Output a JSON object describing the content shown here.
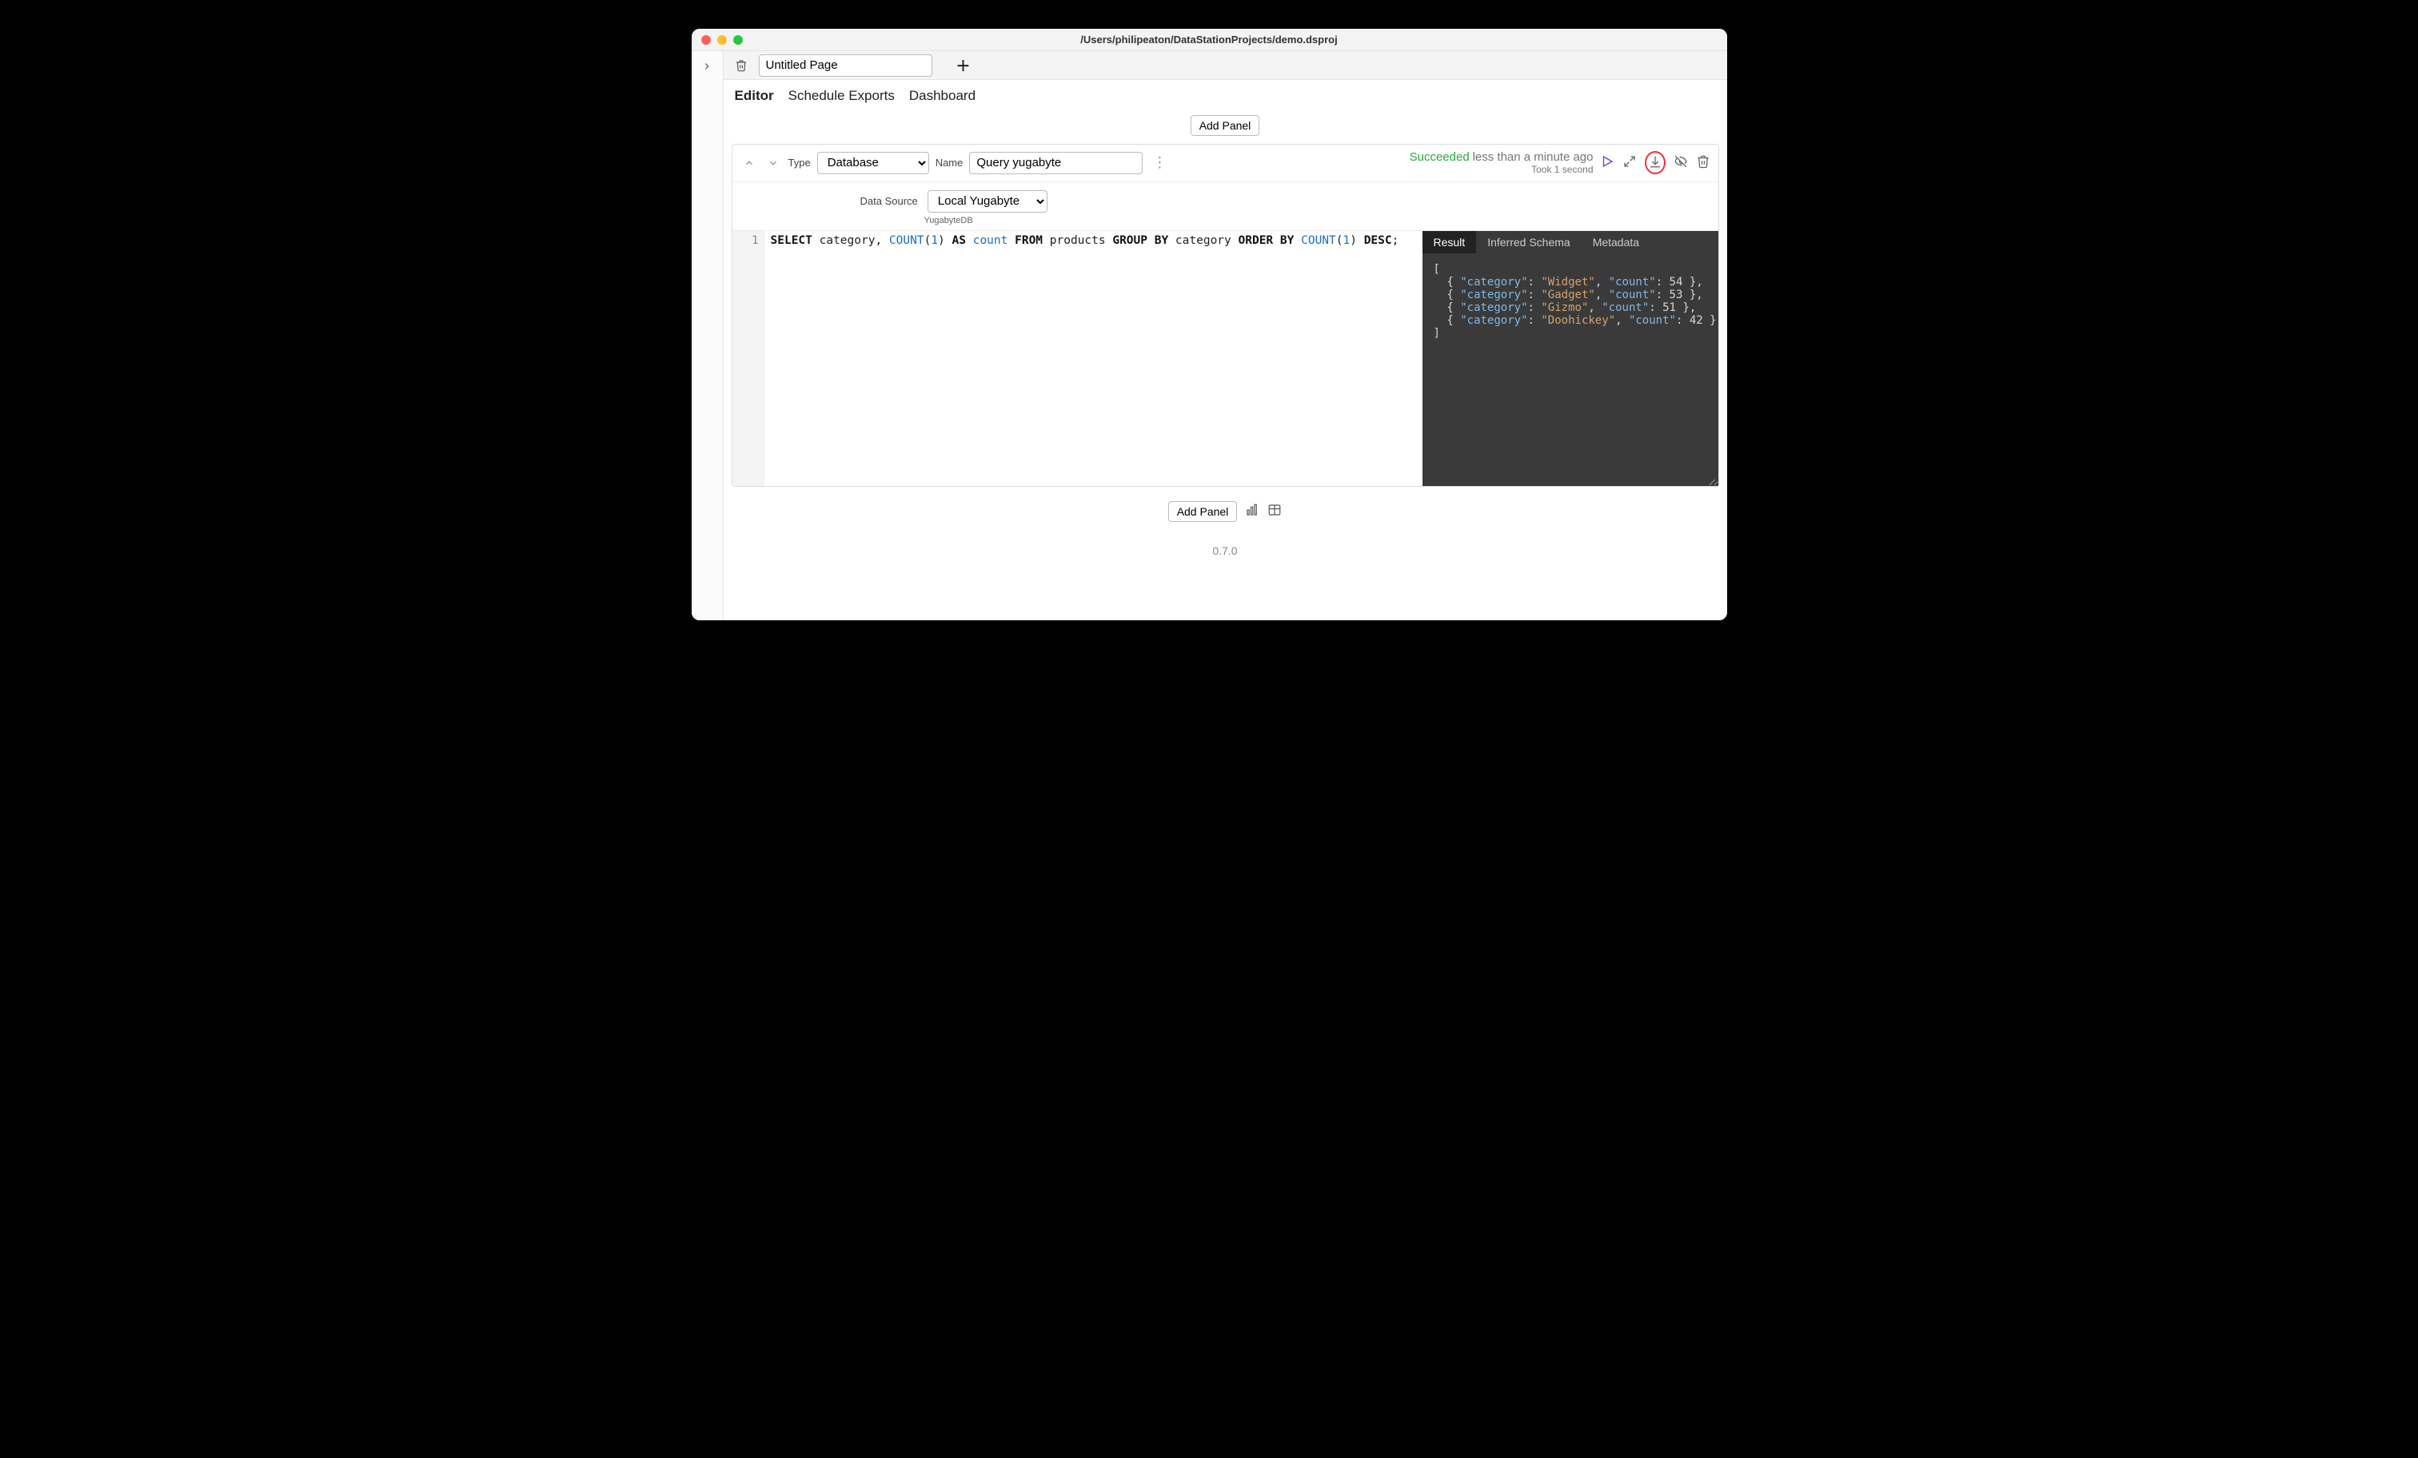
{
  "window": {
    "title": "/Users/philipeaton/DataStationProjects/demo.dsproj"
  },
  "topbar": {
    "page_name": "Untitled Page"
  },
  "tabs": {
    "editor": "Editor",
    "schedule": "Schedule Exports",
    "dashboard": "Dashboard"
  },
  "buttons": {
    "add_panel": "Add Panel"
  },
  "panel": {
    "type_label": "Type",
    "type_value": "Database",
    "name_label": "Name",
    "name_value": "Query yugabyte",
    "status_word": "Succeeded",
    "status_time": "less than a minute ago",
    "status_took": "Took 1 second",
    "ds_label": "Data Source",
    "ds_value": "Local Yugabyte",
    "ds_engine": "YugabyteDB"
  },
  "sql": {
    "line_no": "1",
    "tokens": [
      {
        "t": "kw",
        "v": "SELECT"
      },
      {
        "t": "sp",
        "v": " "
      },
      {
        "t": "id",
        "v": "category,"
      },
      {
        "t": "sp",
        "v": " "
      },
      {
        "t": "fn",
        "v": "COUNT"
      },
      {
        "t": "p",
        "v": "("
      },
      {
        "t": "num",
        "v": "1"
      },
      {
        "t": "p",
        "v": ")"
      },
      {
        "t": "sp",
        "v": " "
      },
      {
        "t": "kw",
        "v": "AS"
      },
      {
        "t": "sp",
        "v": " "
      },
      {
        "t": "id2",
        "v": "count"
      },
      {
        "t": "sp",
        "v": " "
      },
      {
        "t": "kw",
        "v": "FROM"
      },
      {
        "t": "sp",
        "v": " "
      },
      {
        "t": "id",
        "v": "products"
      },
      {
        "t": "sp",
        "v": " "
      },
      {
        "t": "kw",
        "v": "GROUP"
      },
      {
        "t": "sp",
        "v": " "
      },
      {
        "t": "kw",
        "v": "BY"
      },
      {
        "t": "sp",
        "v": " "
      },
      {
        "t": "id",
        "v": "category"
      },
      {
        "t": "sp",
        "v": " "
      },
      {
        "t": "kw",
        "v": "ORDER"
      },
      {
        "t": "sp",
        "v": " "
      },
      {
        "t": "kw",
        "v": "BY"
      },
      {
        "t": "sp",
        "v": " "
      },
      {
        "t": "fn",
        "v": "COUNT"
      },
      {
        "t": "p",
        "v": "("
      },
      {
        "t": "num",
        "v": "1"
      },
      {
        "t": "p",
        "v": ")"
      },
      {
        "t": "sp",
        "v": " "
      },
      {
        "t": "kw",
        "v": "DESC"
      },
      {
        "t": "p",
        "v": ";"
      }
    ]
  },
  "result_tabs": {
    "result": "Result",
    "schema": "Inferred Schema",
    "metadata": "Metadata"
  },
  "result_rows": [
    {
      "category": "Widget",
      "count": 54
    },
    {
      "category": "Gadget",
      "count": 53
    },
    {
      "category": "Gizmo",
      "count": 51
    },
    {
      "category": "Doohickey",
      "count": 42
    }
  ],
  "version": "0.7.0"
}
